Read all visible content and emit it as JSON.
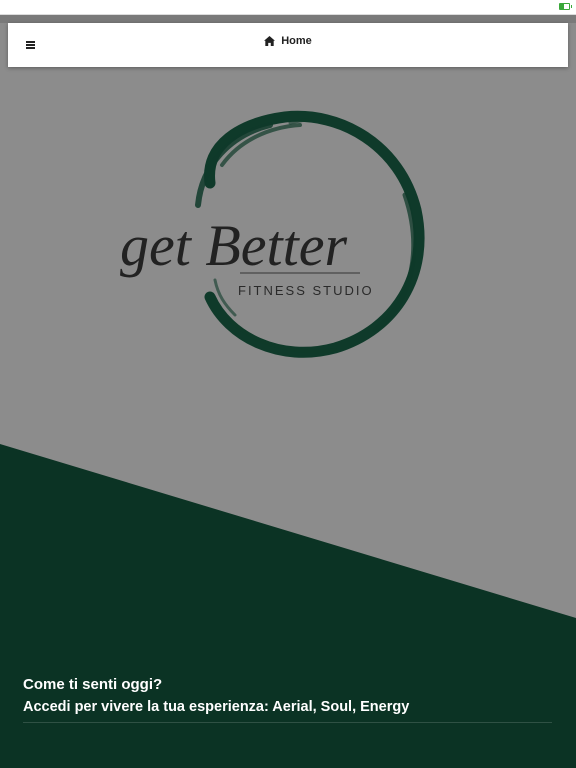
{
  "status_bar": {
    "battery_icon": "battery-charging-icon",
    "battery_color": "#3aa83a"
  },
  "navbar": {
    "menu_icon": "hamburger-menu-icon",
    "home_icon": "home-icon",
    "home_label": "Home"
  },
  "logo": {
    "script_text": "get Better",
    "subtitle": "FITNESS STUDIO",
    "ring_color": "#0f3a2a"
  },
  "hero": {
    "background_color": "#8c8c8c",
    "panel_color": "#0b3324"
  },
  "footer": {
    "question": "Come ti senti oggi?",
    "cta": "Accedi per vivere la tua esperienza: Aerial, Soul, Energy"
  }
}
